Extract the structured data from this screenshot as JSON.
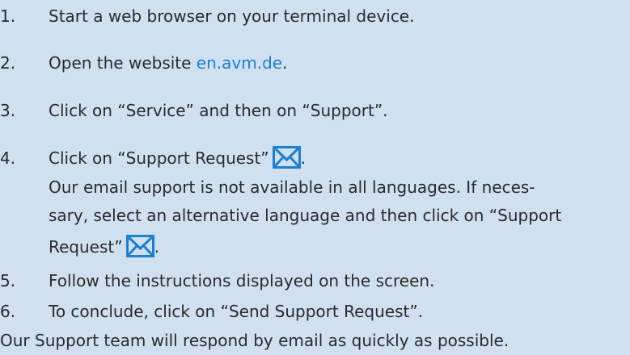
{
  "steps": [
    {
      "number": "1.",
      "text": "Start a web browser on your terminal device."
    },
    {
      "number": "2.",
      "text_before": "Open the website ",
      "link": "en.avm.de",
      "text_after": "."
    },
    {
      "number": "3.",
      "text": "Click on “Service” and then on “Support”."
    },
    {
      "number": "4.",
      "text_before": "Click on “Support Request”",
      "text_after": "."
    },
    {
      "number": "5.",
      "text": "Follow the instructions displayed on the screen."
    },
    {
      "number": "6.",
      "text": "To conclude, click on “Send Support Request”."
    }
  ],
  "step4_note": {
    "line1": "Our email support is not available in all languages. If neces-",
    "line2": "sary, select an alternative language and then click on “Support",
    "line3_before": "Request”",
    "line3_after": "."
  },
  "footer": "Our Support team will respond by email as quickly as possible.",
  "icons": {
    "mail": "envelope-icon"
  },
  "colors": {
    "background": "#cfe0f0",
    "link": "#1c7fd1",
    "icon": "#1c7fd1"
  }
}
